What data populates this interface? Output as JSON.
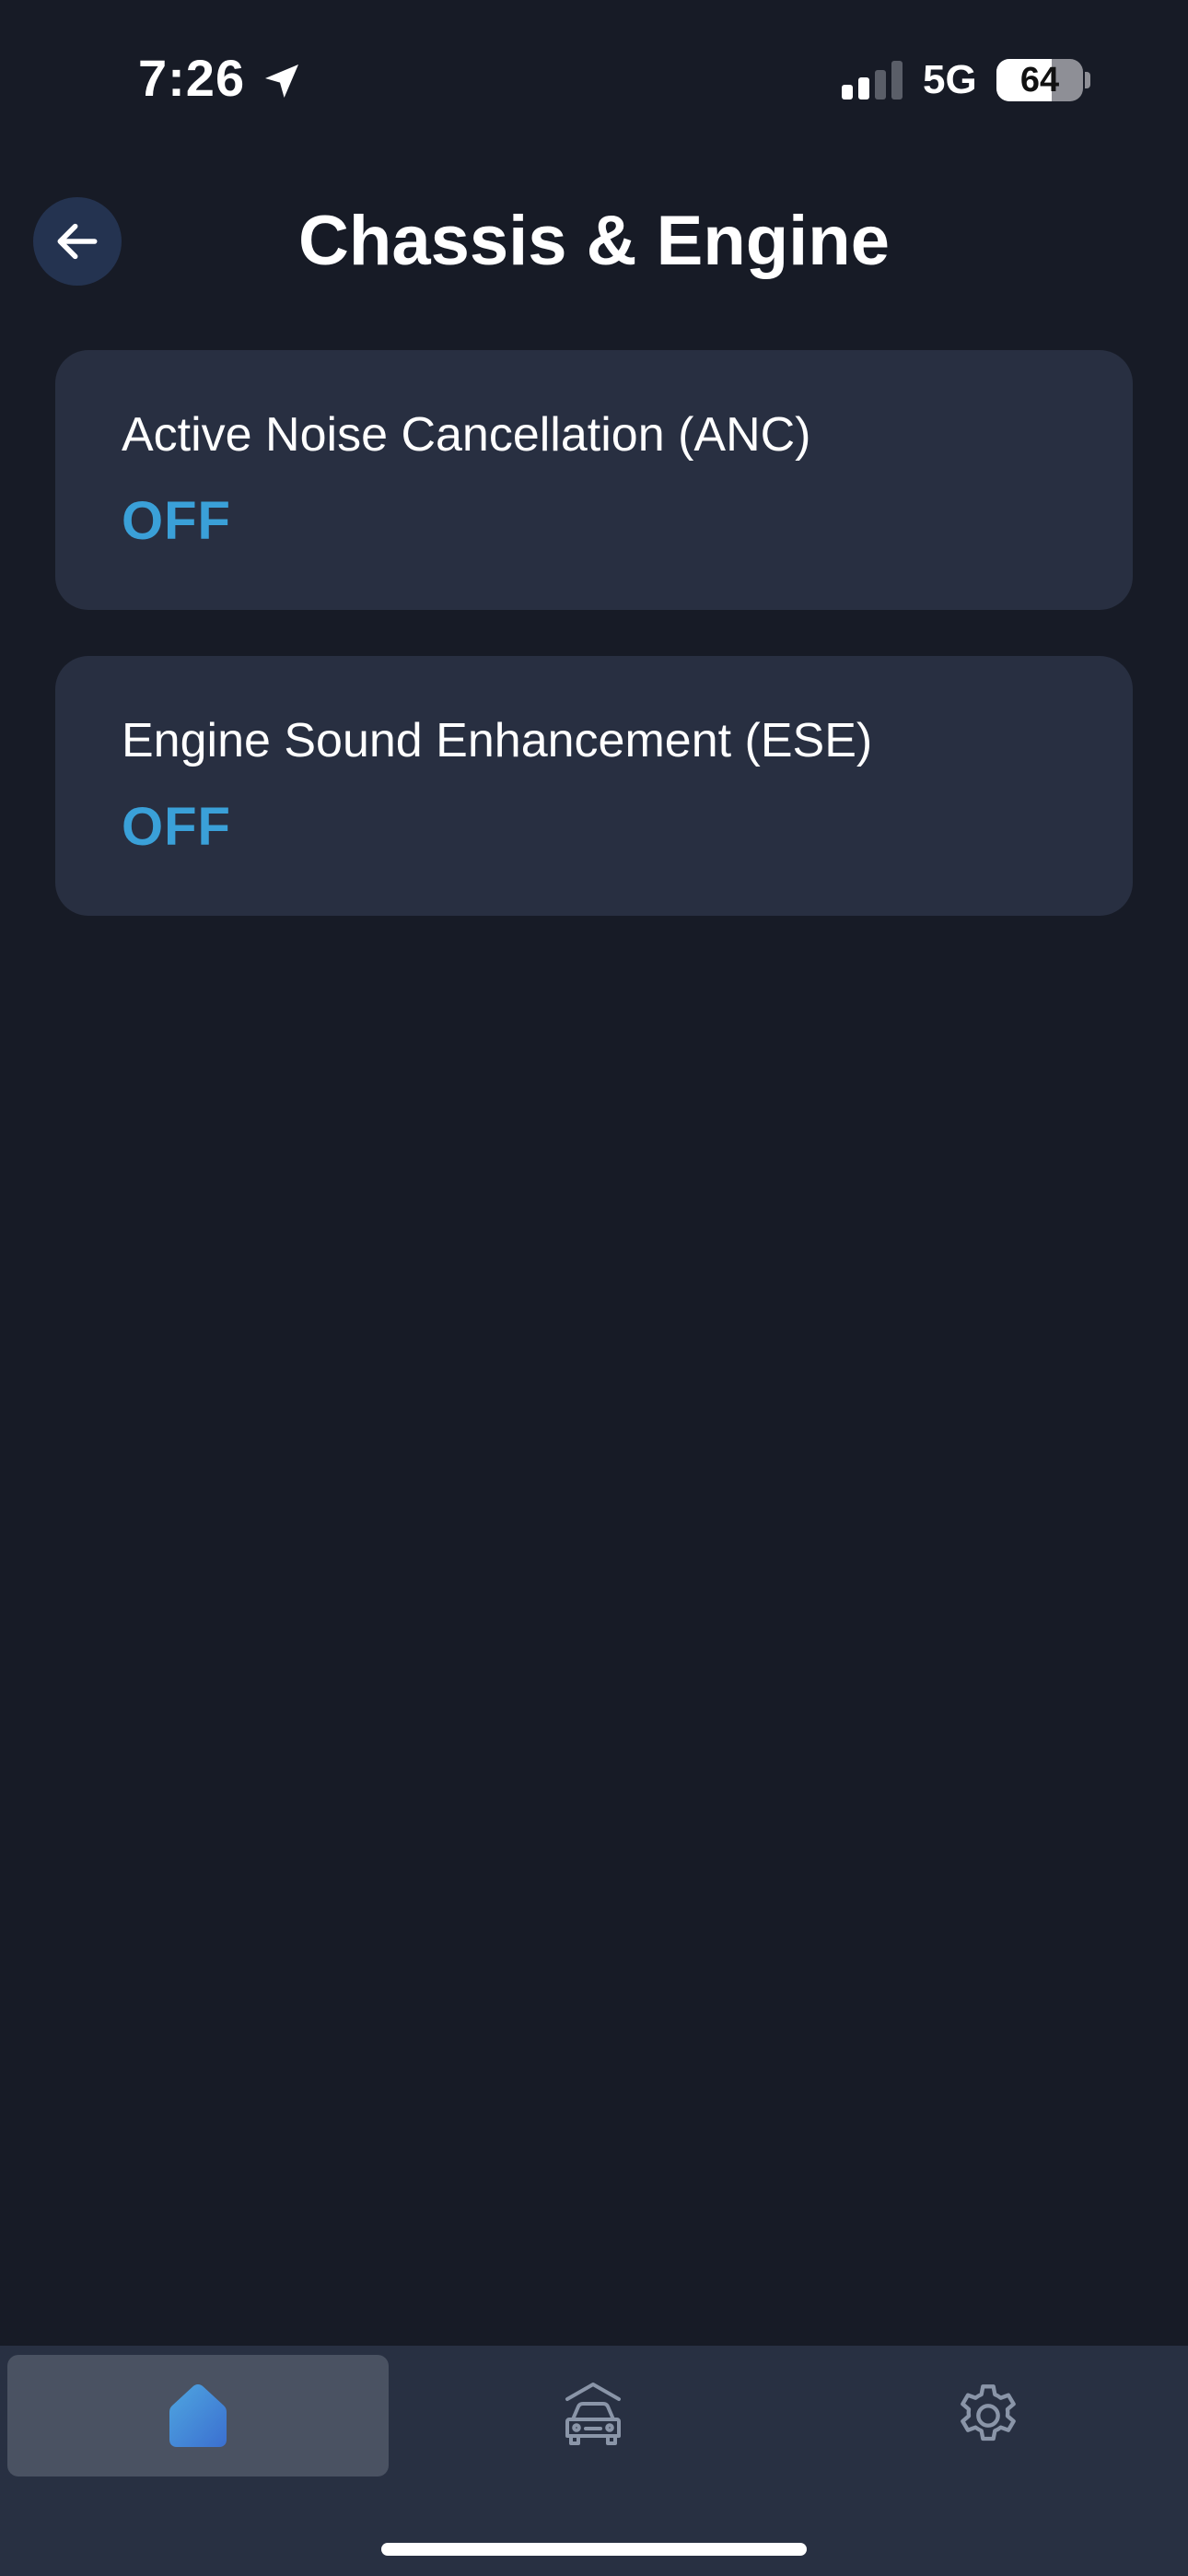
{
  "status_bar": {
    "time": "7:26",
    "network": "5G",
    "battery_level": "64",
    "battery_fraction": 0.64,
    "icons": [
      "location-arrow-icon",
      "signal-icon",
      "battery-icon"
    ]
  },
  "header": {
    "title": "Chassis & Engine",
    "back_icon": "arrow-left-icon"
  },
  "settings": [
    {
      "label": "Active Noise Cancellation (ANC)",
      "value": "OFF"
    },
    {
      "label": "Engine Sound Enhancement (ESE)",
      "value": "OFF"
    }
  ],
  "tab_bar": {
    "tabs": [
      {
        "icon": "home-icon",
        "selected": true
      },
      {
        "icon": "car-icon",
        "selected": false
      },
      {
        "icon": "gear-icon",
        "selected": false
      }
    ]
  },
  "colors": {
    "background": "#171b26",
    "card": "#282f41",
    "accent": "#3aa0d8",
    "tab_bar": "#283042",
    "tab_selected": "#4a5262",
    "back_button": "#243350"
  }
}
